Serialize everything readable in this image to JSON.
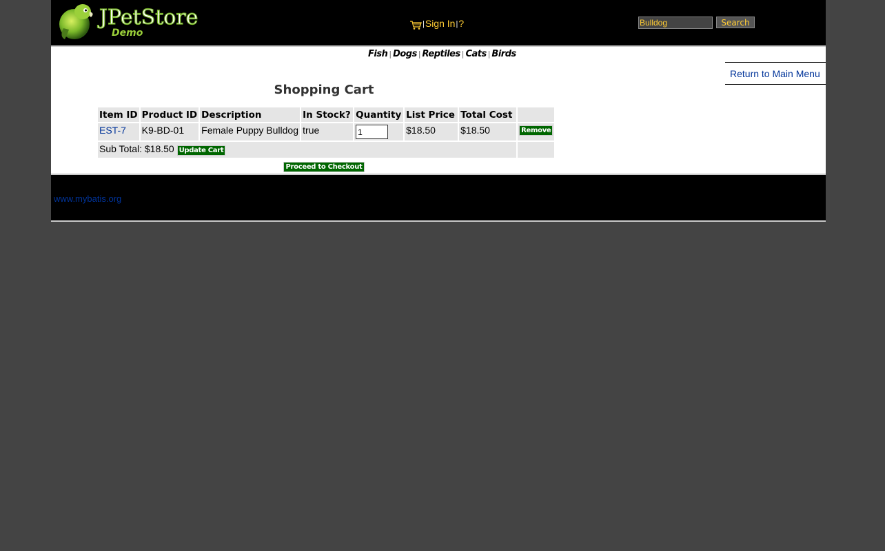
{
  "header": {
    "logo": {
      "title": "JPetStore",
      "subtitle": "Demo"
    },
    "menu": {
      "cart_icon": "shopping-cart-icon",
      "sign_in_label": "Sign In",
      "help_label": "?",
      "separator": "|"
    },
    "search": {
      "value": "Bulldog",
      "button_label": "Search"
    }
  },
  "quick_links": {
    "separator": "|",
    "items": [
      "Fish",
      "Dogs",
      "Reptiles",
      "Cats",
      "Birds"
    ]
  },
  "back_link": "Return to Main Menu",
  "cart": {
    "title": "Shopping Cart",
    "columns": [
      "Item ID",
      "Product ID",
      "Description",
      "In Stock?",
      "Quantity",
      "List Price",
      "Total Cost",
      ""
    ],
    "rows": [
      {
        "item_id": "EST-7",
        "product_id": "K9-BD-01",
        "description": "Female Puppy Bulldog",
        "in_stock": "true",
        "quantity": "1",
        "list_price": "$18.50",
        "total_cost": "$18.50",
        "remove_label": "Remove"
      }
    ],
    "subtotal_label": "Sub Total: $18.50",
    "update_label": "Update Cart",
    "checkout_label": "Proceed to Checkout"
  },
  "footer": {
    "link_text": "www.mybatis.org"
  },
  "colors": {
    "background": "#444444",
    "header": "#000000",
    "accent_yellow": "#ffcc33",
    "link_blue": "#003399",
    "button_green": "#006600",
    "table_cell": "#e5e5e5"
  }
}
